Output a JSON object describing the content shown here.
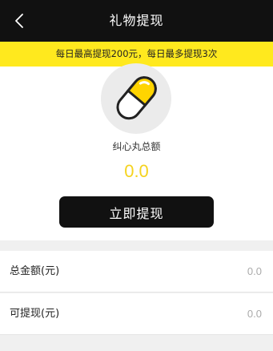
{
  "header": {
    "title": "礼物提现",
    "back_icon": "chevron-left-icon"
  },
  "notice": {
    "text": "每日最高提现200元，每日最多提现3次",
    "background": "#ffe91e"
  },
  "hero": {
    "icon": "pill-capsule-icon",
    "label": "纠心丸总额",
    "amount": "0.0",
    "amount_color": "#f5d31e",
    "button_label": "立即提现"
  },
  "rows": [
    {
      "label": "总金额(元)",
      "value": "0.0"
    },
    {
      "label": "可提现(元)",
      "value": "0.0"
    }
  ],
  "colors": {
    "accent": "#ffe91e",
    "dark": "#111111"
  }
}
